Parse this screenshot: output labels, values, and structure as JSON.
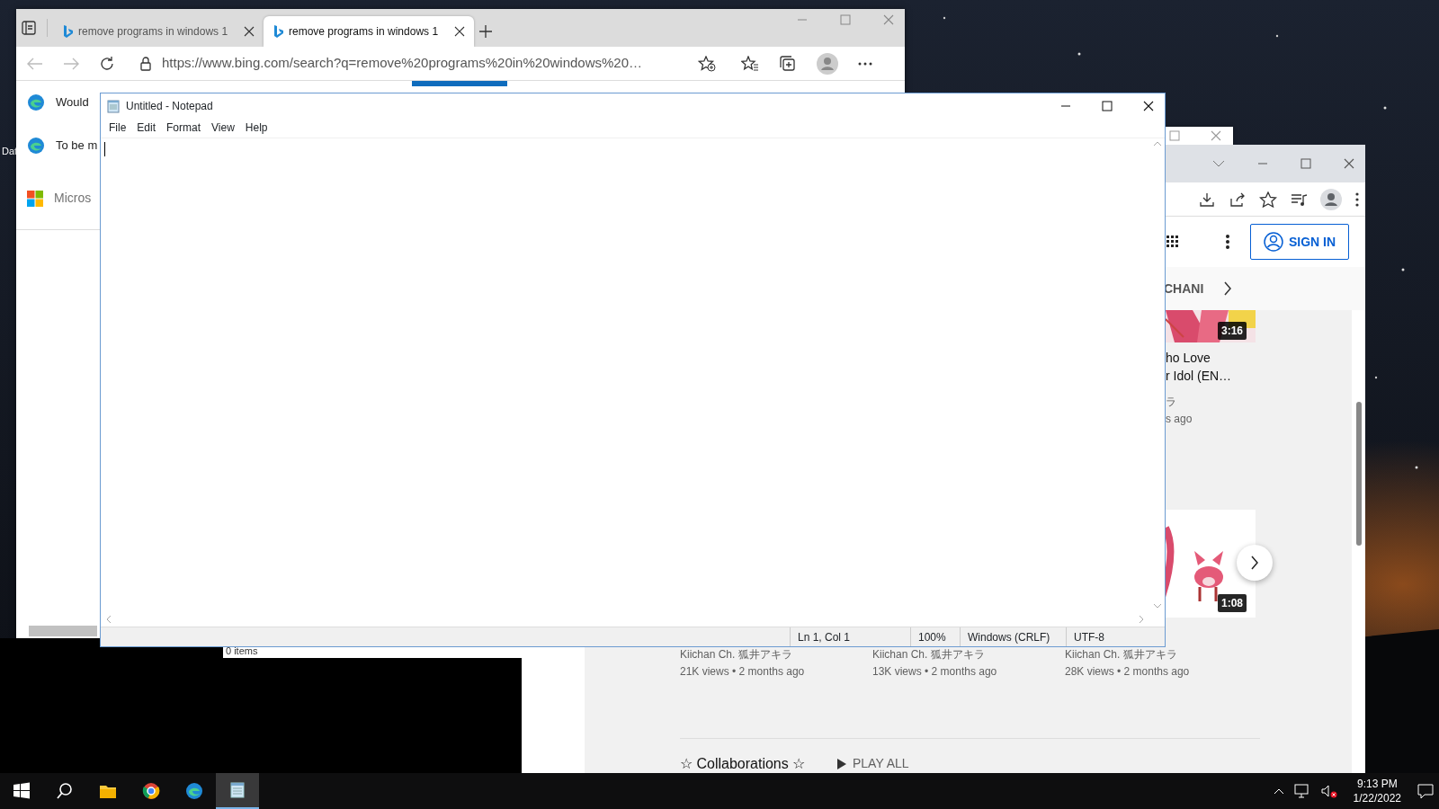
{
  "desktop": {
    "icon_label": "Dat"
  },
  "browser_window": {
    "tabs": [
      {
        "title": "remove programs in windows 1",
        "selected": false
      },
      {
        "title": "remove programs in windows 1",
        "selected": true
      }
    ],
    "address": "https://www.bing.com/search?q=remove%20programs%20in%20windows%20…",
    "rows": [
      {
        "kind": "edge",
        "text": "Would"
      },
      {
        "kind": "edge",
        "text": "To be m"
      },
      {
        "kind": "microsoft",
        "text": "Micros"
      }
    ]
  },
  "video_window": {
    "sign_in": "SIGN IN",
    "chip": "CHANI",
    "videos_right": [
      {
        "duration": "3:16",
        "title_lines": [
          "ho Love",
          "r Idol (EN…"
        ],
        "channel": "ラ",
        "meta": "s ago"
      },
      {
        "duration": "1:08"
      }
    ],
    "videos_below": [
      {
        "channel": "Kiichan Ch. 狐井アキラ",
        "meta": "21K views • 2 months ago"
      },
      {
        "channel": "Kiichan Ch. 狐井アキラ",
        "meta": "13K views • 2 months ago"
      },
      {
        "channel": "Kiichan Ch. 狐井アキラ",
        "meta": "28K views • 2 months ago"
      }
    ],
    "section_title": "☆ Collaborations ☆",
    "play_all": "PLAY ALL"
  },
  "explorer_window": {
    "status": "0 items"
  },
  "notepad": {
    "title": "Untitled - Notepad",
    "menu": [
      "File",
      "Edit",
      "Format",
      "View",
      "Help"
    ],
    "status": [
      "Ln 1, Col 1",
      "100%",
      "Windows (CRLF)",
      "UTF-8"
    ]
  },
  "taskbar": {
    "apps": [
      {
        "kind": "explorer",
        "selected": false
      },
      {
        "kind": "chrome",
        "selected": false
      },
      {
        "kind": "edge",
        "selected": false
      },
      {
        "kind": "notepad",
        "selected": true
      }
    ],
    "volume_muted": true,
    "time": "9:13 PM",
    "date": "1/22/2022"
  }
}
